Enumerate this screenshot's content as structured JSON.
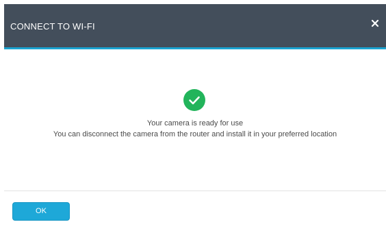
{
  "dialog": {
    "title": "CONNECT TO WI-FI",
    "close_icon": "close-icon",
    "status_icon": "check-circle-icon",
    "message_line1": "Your camera is ready for use",
    "message_line2": "You can disconnect the camera from the router and install it in your preferred location",
    "ok_label": "OK"
  },
  "colors": {
    "header_bg": "#434e5b",
    "header_accent": "#1aa3d1",
    "success_green": "#22b45b",
    "button_blue": "#1ea8d8"
  }
}
